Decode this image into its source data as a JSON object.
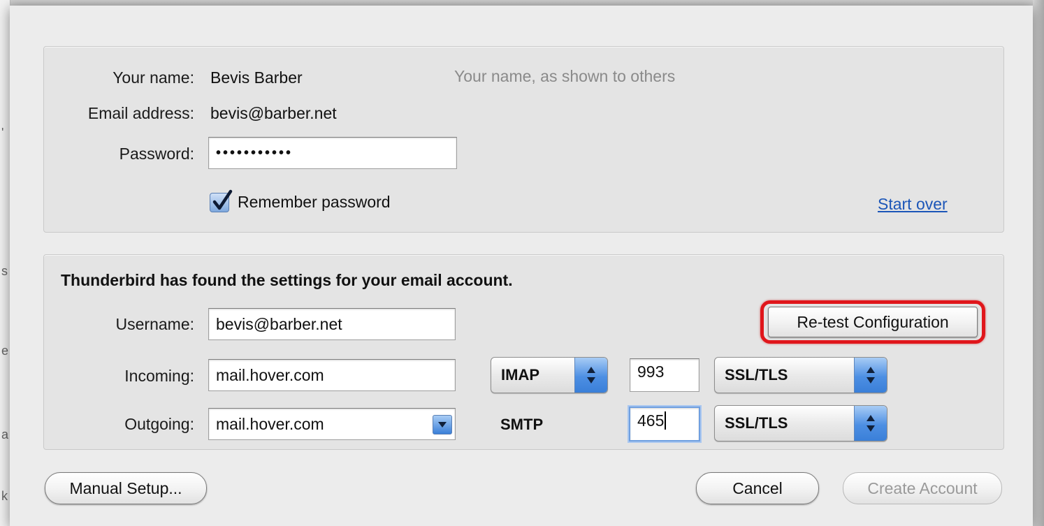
{
  "identity": {
    "name_label": "Your name:",
    "name_value": "Bevis Barber",
    "name_hint": "Your name, as shown to others",
    "email_label": "Email address:",
    "email_value": "bevis@barber.net",
    "password_label": "Password:",
    "password_value": "•••••••••••",
    "remember_label": "Remember password",
    "remember_checked": true,
    "start_over_label": "Start over"
  },
  "settings": {
    "found_message": "Thunderbird has found the settings for your email account.",
    "username_label": "Username:",
    "username_value": "bevis@barber.net",
    "retest_label": "Re-test Configuration",
    "incoming_label": "Incoming:",
    "incoming_host": "mail.hover.com",
    "incoming_protocol": "IMAP",
    "incoming_port": "993",
    "incoming_security": "SSL/TLS",
    "outgoing_label": "Outgoing:",
    "outgoing_host": "mail.hover.com",
    "outgoing_protocol": "SMTP",
    "outgoing_port": "465",
    "outgoing_security": "SSL/TLS"
  },
  "footer": {
    "manual_setup_label": "Manual Setup...",
    "cancel_label": "Cancel",
    "create_account_label": "Create Account"
  },
  "colors": {
    "highlight": "#e0161b",
    "link": "#1c56b8",
    "select_accent": "#3a7fd8"
  }
}
